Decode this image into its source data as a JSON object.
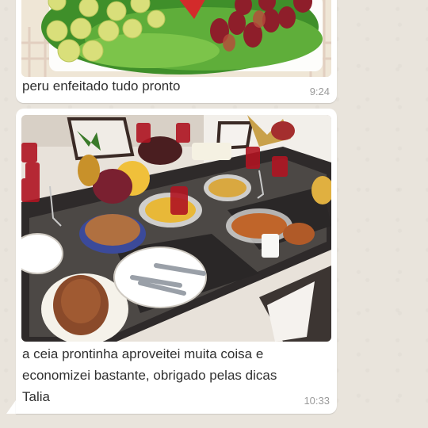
{
  "messages": [
    {
      "caption": "peru enfeitado tudo pronto",
      "time": "9:24",
      "image": "grapes-lettuce-platter-photo"
    },
    {
      "caption_lines": [
        "a ceia prontinha aproveitei muita coisa e",
        "economizei bastante, obrigado pelas dicas",
        "Talia"
      ],
      "time": "10:33",
      "image": "christmas-dinner-table-photo"
    }
  ],
  "colors": {
    "chat_background": "#e9e4dc",
    "bubble": "#ffffff",
    "text": "#303030",
    "timestamp": "#9a9a9a"
  }
}
